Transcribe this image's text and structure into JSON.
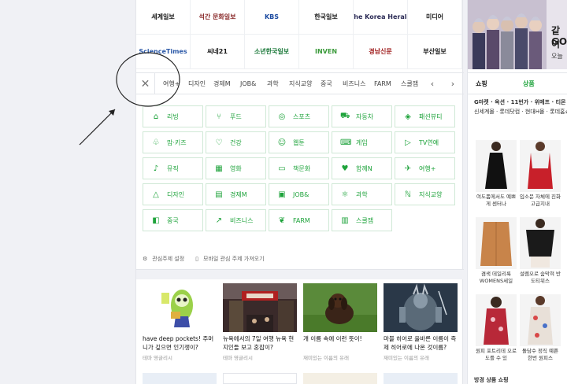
{
  "press": [
    {
      "label": "세계일보",
      "color": "#1a1a1a"
    },
    {
      "label": "석간 문화일보",
      "color": "#8a2b2b"
    },
    {
      "label": "KBS",
      "color": "#1b4aa0"
    },
    {
      "label": "한국일보",
      "color": "#1a1a1a"
    },
    {
      "label": "The Korea Herald",
      "color": "#2a2a55"
    },
    {
      "label": "미디어",
      "color": "#1a1a1a"
    },
    {
      "label": "ScienceTimes",
      "color": "#2d5aa8"
    },
    {
      "label": "씨네21",
      "color": "#1a1a1a"
    },
    {
      "label": "소년한국일보",
      "color": "#1d7a3c"
    },
    {
      "label": "INVEN",
      "color": "#3a9a3a"
    },
    {
      "label": "경남신문",
      "color": "#a02020"
    },
    {
      "label": "부산일보",
      "color": "#1a1a1a"
    }
  ],
  "tabs": [
    "여행+",
    "디자인",
    "경제M",
    "JOB&",
    "과학",
    "지식교양",
    "중국",
    "비즈니스",
    "FARM",
    "스쿨잼"
  ],
  "categories": [
    {
      "label": "리빙",
      "icon": "⌂",
      "iconName": "living-icon"
    },
    {
      "label": "푸드",
      "icon": "⑂",
      "iconName": "food-icon"
    },
    {
      "label": "스포츠",
      "icon": "◎",
      "iconName": "sports-icon"
    },
    {
      "label": "자동차",
      "icon": "⛟",
      "iconName": "car-icon"
    },
    {
      "label": "패션뷰티",
      "icon": "◈",
      "iconName": "fashion-icon"
    },
    {
      "label": "맘·키즈",
      "icon": "♧",
      "iconName": "kids-icon"
    },
    {
      "label": "건강",
      "icon": "♡",
      "iconName": "health-icon"
    },
    {
      "label": "웹툰",
      "icon": "☺",
      "iconName": "webtoon-icon"
    },
    {
      "label": "게임",
      "icon": "⌨",
      "iconName": "game-icon"
    },
    {
      "label": "TV연예",
      "icon": "▷",
      "iconName": "tv-icon"
    },
    {
      "label": "뮤직",
      "icon": "♪",
      "iconName": "music-icon"
    },
    {
      "label": "영화",
      "icon": "▦",
      "iconName": "movie-icon"
    },
    {
      "label": "책문화",
      "icon": "▭",
      "iconName": "book-icon"
    },
    {
      "label": "함께N",
      "icon": "♥",
      "iconName": "together-icon"
    },
    {
      "label": "여행+",
      "icon": "✈",
      "iconName": "travel-icon"
    },
    {
      "label": "디자인",
      "icon": "△",
      "iconName": "design-icon"
    },
    {
      "label": "경제M",
      "icon": "▤",
      "iconName": "economy-icon"
    },
    {
      "label": "JOB&",
      "icon": "▣",
      "iconName": "job-icon"
    },
    {
      "label": "과학",
      "icon": "⚛",
      "iconName": "science-icon"
    },
    {
      "label": "지식교양",
      "icon": "ℕ",
      "iconName": "knowledge-icon"
    },
    {
      "label": "중국",
      "icon": "◧",
      "iconName": "china-icon"
    },
    {
      "label": "비즈니스",
      "icon": "↗",
      "iconName": "business-icon"
    },
    {
      "label": "FARM",
      "icon": "❦",
      "iconName": "farm-icon"
    },
    {
      "label": "스쿨잼",
      "icon": "▥",
      "iconName": "school-icon"
    }
  ],
  "settings": {
    "interest_label": "관심주제 설정",
    "mobile_label": "모바일 관심 주제 가져오기"
  },
  "cards": [
    {
      "title": "have deep pockets! 주머니가 깊으면 인기쟁이?",
      "source": "테마 영글리시"
    },
    {
      "title": "뉴욕에서의 7일 여행 뉴욕 현지인들 보고 혼잡이?",
      "source": "테마 영글리시"
    },
    {
      "title": "개 이름 속에 이런 뜻이!",
      "source": "재미있는 이름의 유래"
    },
    {
      "title": "마블 히어로 올바른 이름이 즉제 히어로에 나온 것이름?",
      "source": "재미있는 이름의 유래"
    }
  ],
  "right": {
    "banner_text_1": "같이",
    "banner_text_2": "GO",
    "banner_text_3": "오늘",
    "shop_tab_1": "쇼핑",
    "shop_tab_2": "상품",
    "shop_links_1": "G마켓 · 옥션 · 11번가 · 위메프 · 티몬",
    "shop_links_2": "신세계몰 · 롯데닷컴 · 현대H몰 · 롯데홈쇼핑",
    "products": [
      {
        "caption": "여도폼에서도 예쁘게 센터나"
      },
      {
        "caption": "입소문 자체에 진화 고급지내"
      },
      {
        "caption": "겸색 데일리룩 WOMENS세일"
      },
      {
        "caption": "설렘오로 숨막혀 반도티위스"
      },
      {
        "caption": "원피 포트리데 오로도를 수 있"
      },
      {
        "caption": "돌담수 정직 예쁜 한번 원피스"
      }
    ],
    "footer": "방경 상품 쇼핑"
  }
}
